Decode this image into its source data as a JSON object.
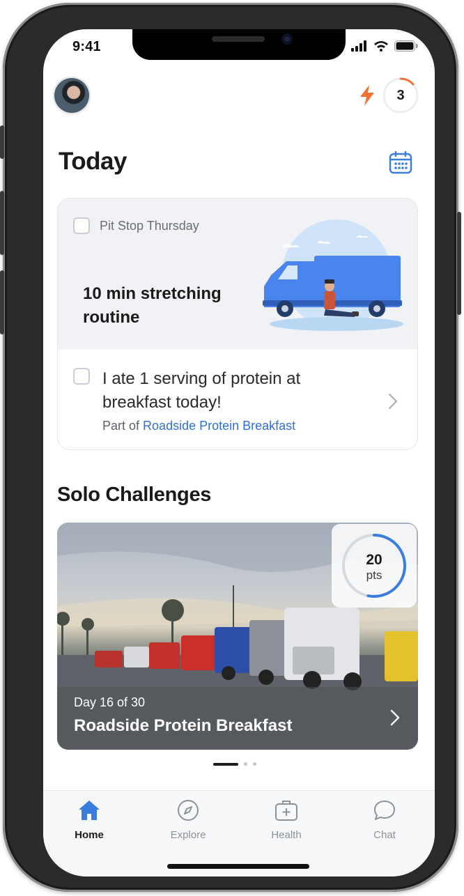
{
  "status_bar": {
    "time": "9:41"
  },
  "header": {
    "streak_count": "3",
    "colors": {
      "bolt": "#f07236",
      "streak_ring": "#f07236"
    }
  },
  "today": {
    "title": "Today",
    "tasks": [
      {
        "label": "Pit Stop Thursday",
        "title": "10 min stretching routine",
        "checked": false
      },
      {
        "text": "I ate 1 serving of protein at breakfast today!",
        "part_of_prefix": "Part of",
        "part_of_link": "Roadside Protein Breakfast",
        "checked": false
      }
    ]
  },
  "solo_challenges": {
    "title": "Solo Challenges",
    "cards": [
      {
        "points_value": "20",
        "points_unit": "pts",
        "progress_fraction": 0.53,
        "day_label": "Day 16 of 30",
        "name": "Roadside Protein Breakfast"
      }
    ],
    "page_count": 3,
    "active_page": 1
  },
  "tab_bar": {
    "items": [
      {
        "label": "Home",
        "icon": "home-icon",
        "active": true
      },
      {
        "label": "Explore",
        "icon": "compass-icon",
        "active": false
      },
      {
        "label": "Health",
        "icon": "medical-kit-icon",
        "active": false
      },
      {
        "label": "Chat",
        "icon": "chat-bubble-icon",
        "active": false
      }
    ]
  },
  "colors": {
    "accent": "#3b7ddd",
    "link": "#2f6fdc",
    "text": "#1a1a1a"
  }
}
